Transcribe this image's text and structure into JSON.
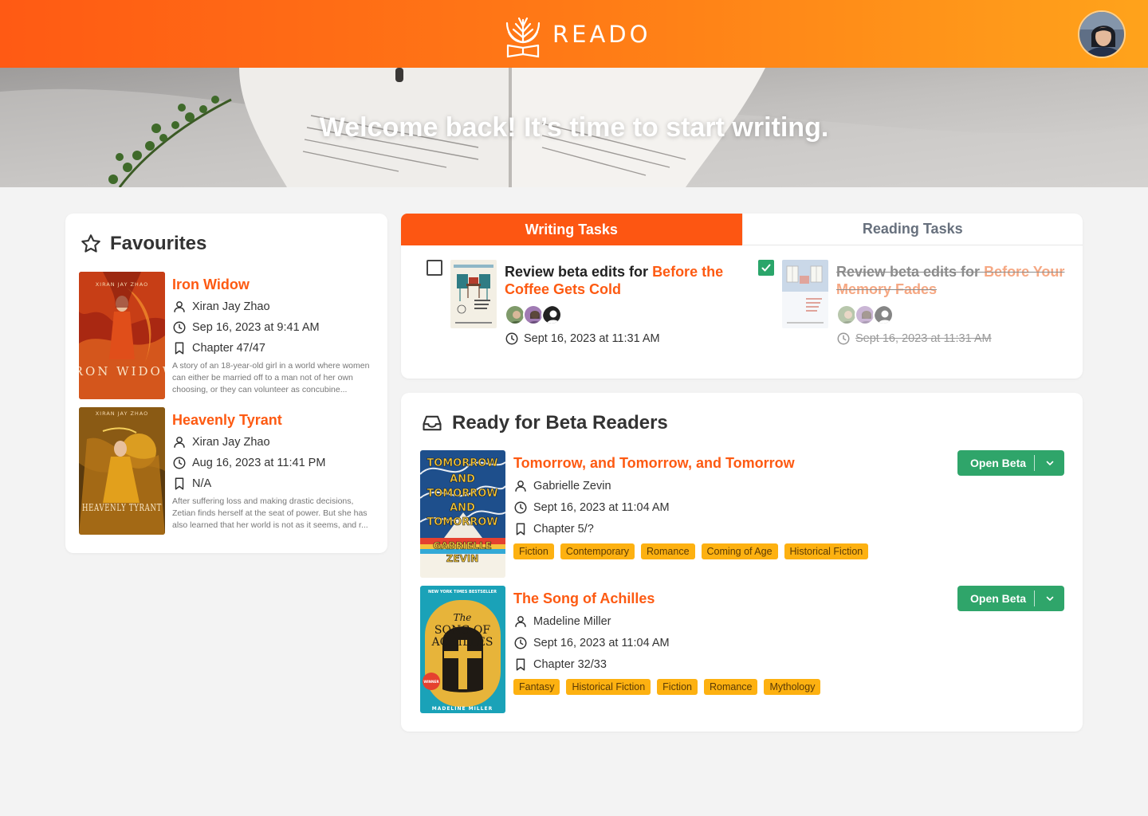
{
  "app": {
    "name": "READO"
  },
  "hero": {
    "title": "Welcome back! It’s time to start writing."
  },
  "favourites": {
    "title": "Favourites",
    "items": [
      {
        "title": "Iron Widow",
        "author": "Xiran Jay Zhao",
        "date": "Sep 16, 2023 at 9:41 AM",
        "chapter": "Chapter 47/47",
        "description": "A story of an 18-year-old girl in a world where women can either be married off to a man not of her own choosing, or they can volunteer as concubine...",
        "cover_text": "IRON WIDOW",
        "cover_header": "XIRAN JAY ZHAO"
      },
      {
        "title": "Heavenly Tyrant",
        "author": "Xiran Jay Zhao",
        "date": "Aug 16, 2023 at 11:41 PM",
        "chapter": "N/A",
        "description": "After suffering loss and making drastic decisions, Zetian finds herself at the seat of power. But she has also learned that her world is not as it seems, and r...",
        "cover_text": "HEAVENLY TYRANT",
        "cover_header": "XIRAN JAY ZHAO"
      }
    ]
  },
  "tasks": {
    "tabs": [
      {
        "label": "Writing Tasks",
        "active": true
      },
      {
        "label": "Reading Tasks",
        "active": false
      }
    ],
    "items": [
      {
        "prefix": "Review beta edits for ",
        "book": "Before the Coffee Gets Cold",
        "time": "Sept 16, 2023 at 11:31 AM",
        "done": false
      },
      {
        "prefix": "Review beta edits for ",
        "book": "Before Your Memory Fades",
        "time": "Sept 16, 2023 at 11:31 AM",
        "done": true
      }
    ]
  },
  "beta": {
    "title": "Ready for Beta Readers",
    "button_label": "Open Beta",
    "items": [
      {
        "title": "Tomorrow, and Tomorrow, and Tomorrow",
        "author": "Gabrielle Zevin",
        "date": "Sept 16, 2023 at 11:04 AM",
        "chapter": "Chapter 5/?",
        "tags": [
          "Fiction",
          "Contemporary",
          "Romance",
          "Coming of Age",
          "Historical Fiction"
        ]
      },
      {
        "title": "The Song of Achilles",
        "author": "Madeline Miller",
        "date": "Sept 16, 2023 at 11:04 AM",
        "chapter": "Chapter 32/33",
        "tags": [
          "Fantasy",
          "Historical Fiction",
          "Fiction",
          "Romance",
          "Mythology"
        ]
      }
    ]
  },
  "colors": {
    "brand": "#fd5a12",
    "tag": "#fdb111",
    "button": "#2fa56a"
  },
  "icons": {
    "logo": "tree-book-icon",
    "favourites": "star-icon",
    "beta": "inbox-icon",
    "author": "user-icon",
    "date": "clock-icon",
    "chapter": "bookmark-icon",
    "dropdown": "chevron-down-icon",
    "check": "check-icon"
  }
}
